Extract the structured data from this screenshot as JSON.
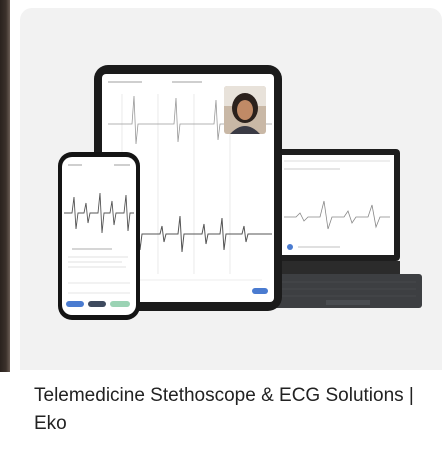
{
  "result": {
    "title": "Telemedicine Stethoscope & ECG Solutions | Eko"
  },
  "colors": {
    "thumb_bg": "#f2f2f2",
    "caption": "#222222",
    "accent_blue": "#4a7bd0",
    "accent_green": "#9bd3b4",
    "waveform": "#555555"
  },
  "image": {
    "subject_icons": [
      "phone-device",
      "tablet-device",
      "laptop-device",
      "doctor-video-icon"
    ]
  }
}
